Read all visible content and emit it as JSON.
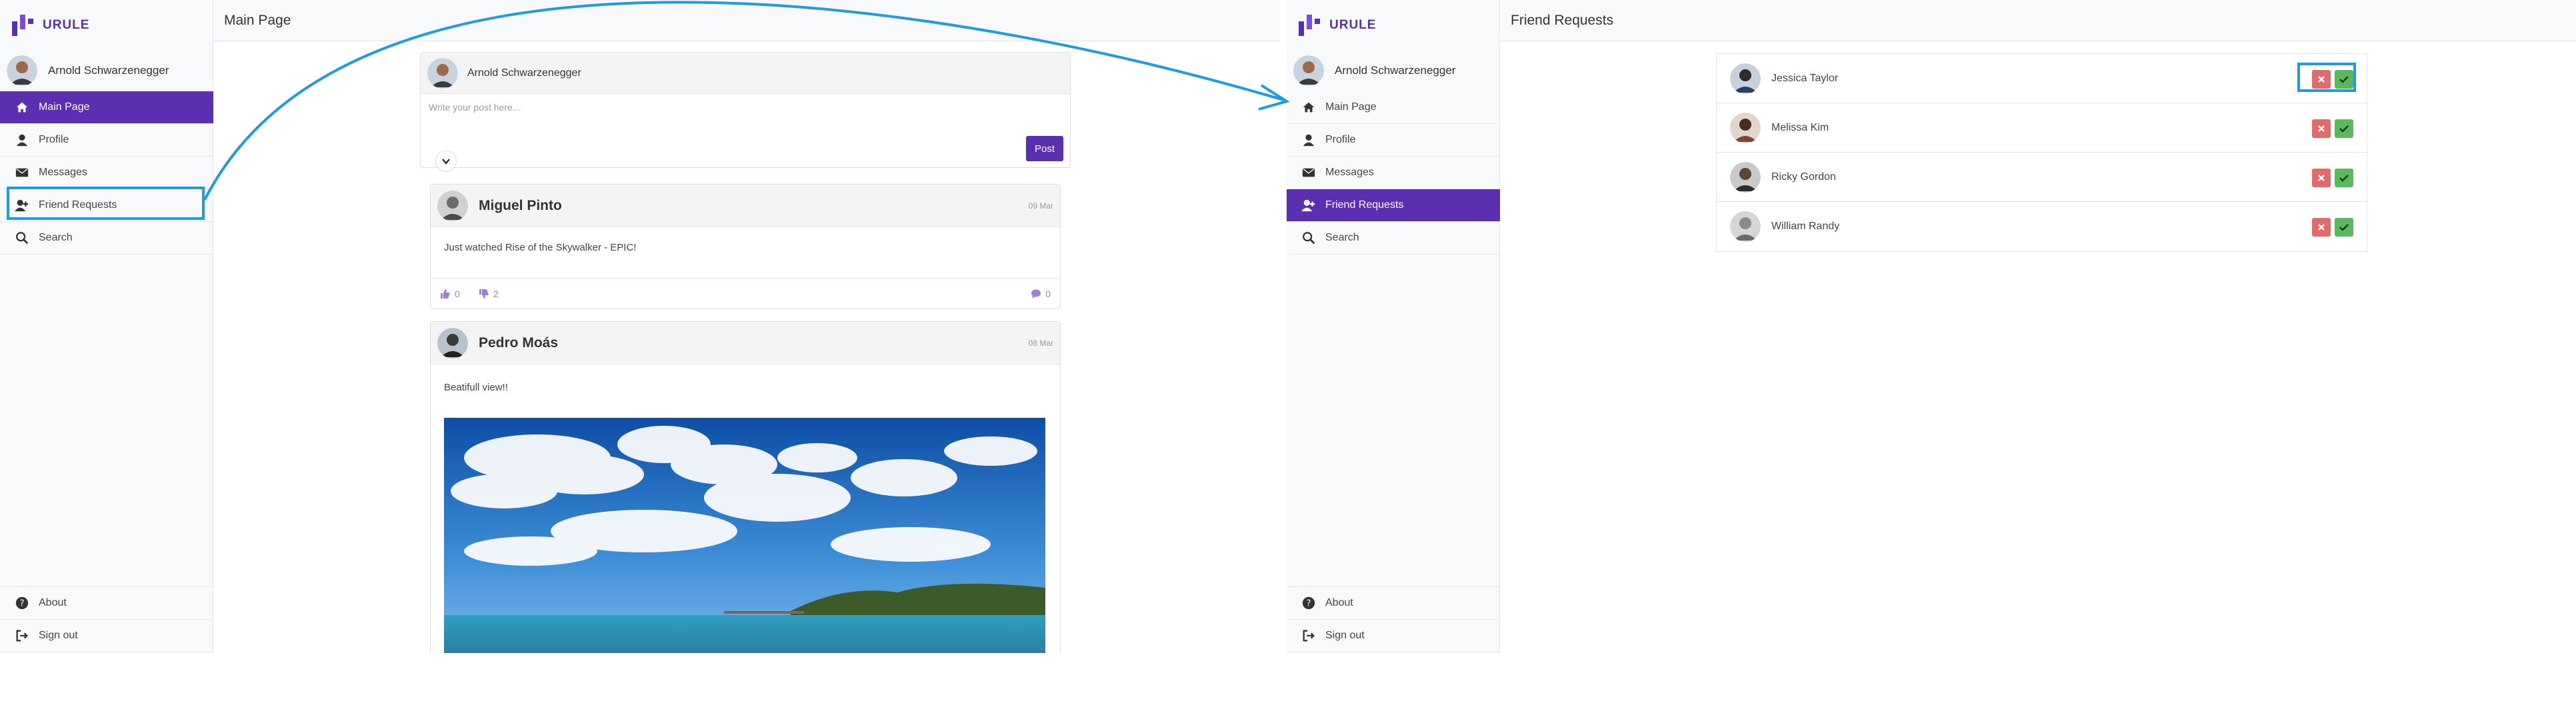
{
  "brand": {
    "name": "URULE",
    "accent": "#5a2fb0"
  },
  "user": {
    "name": "Arnold Schwarzenegger"
  },
  "nav": {
    "items": [
      {
        "label": "Main Page",
        "icon": "home-icon"
      },
      {
        "label": "Profile",
        "icon": "user-icon"
      },
      {
        "label": "Messages",
        "icon": "envelope-icon"
      },
      {
        "label": "Friend Requests",
        "icon": "user-plus-icon"
      },
      {
        "label": "Search",
        "icon": "search-icon"
      }
    ],
    "bottom": [
      {
        "label": "About",
        "icon": "question-icon"
      },
      {
        "label": "Sign out",
        "icon": "sign-out-icon"
      }
    ]
  },
  "main_page": {
    "title": "Main Page",
    "composer": {
      "author": "Arnold Schwarzenegger",
      "placeholder": "Write your post here...",
      "post_label": "Post"
    },
    "posts": [
      {
        "author": "Miguel Pinto",
        "date": "09 Mar",
        "text": "Just watched Rise of the Skywalker - EPIC!",
        "likes": "0",
        "dislikes": "2",
        "comments": "0"
      },
      {
        "author": "Pedro Moás",
        "date": "08 Mar",
        "text": "Beatifull view!!"
      }
    ]
  },
  "friend_requests_page": {
    "title": "Friend Requests",
    "requests": [
      {
        "name": "Jessica Taylor"
      },
      {
        "name": "Melissa Kim"
      },
      {
        "name": "Ricky Gordon"
      },
      {
        "name": "William Randy"
      }
    ]
  },
  "annotation": {
    "color": "#1f9bde"
  }
}
